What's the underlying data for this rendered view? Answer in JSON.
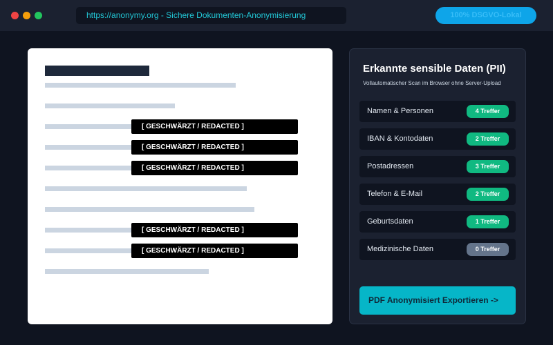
{
  "browser": {
    "url_text": "https://anonymy.org - Sichere Dokumenten-Anonymisierung",
    "badge": "100% DSGVO-Lokal",
    "dots": [
      "#ef4444",
      "#f59e0b",
      "#22c55e"
    ]
  },
  "document": {
    "redaction_label": "[ GESCHWÄRZT / REDACTED ]",
    "redactions": [
      "[ GESCHWÄRZT / REDACTED ]",
      "[ GESCHWÄRZT / REDACTED ]",
      "[ GESCHWÄRZT / REDACTED ]",
      "[ GESCHWÄRZT / REDACTED ]",
      "[ GESCHWÄRZT / REDACTED ]"
    ]
  },
  "panel": {
    "title": "Erkannte sensible Daten (PII)",
    "subtitle": "Vollautomatischer Scan im Browser ohne Server-Upload",
    "items": [
      {
        "label": "Namen & Personen",
        "count": "4 Treffer",
        "color": "#10b981"
      },
      {
        "label": "IBAN & Kontodaten",
        "count": "2 Treffer",
        "color": "#10b981"
      },
      {
        "label": "Postadressen",
        "count": "3 Treffer",
        "color": "#10b981"
      },
      {
        "label": "Telefon & E-Mail",
        "count": "2 Treffer",
        "color": "#10b981"
      },
      {
        "label": "Geburtsdaten",
        "count": "1 Treffer",
        "color": "#10b981"
      },
      {
        "label": "Medizinische Daten",
        "count": "0 Treffer",
        "color": "#64748b"
      }
    ],
    "export_label": "PDF Anonymisiert Exportieren ->"
  },
  "colors": {
    "accent": "#06b6c8",
    "success": "#10b981",
    "muted": "#64748b"
  }
}
